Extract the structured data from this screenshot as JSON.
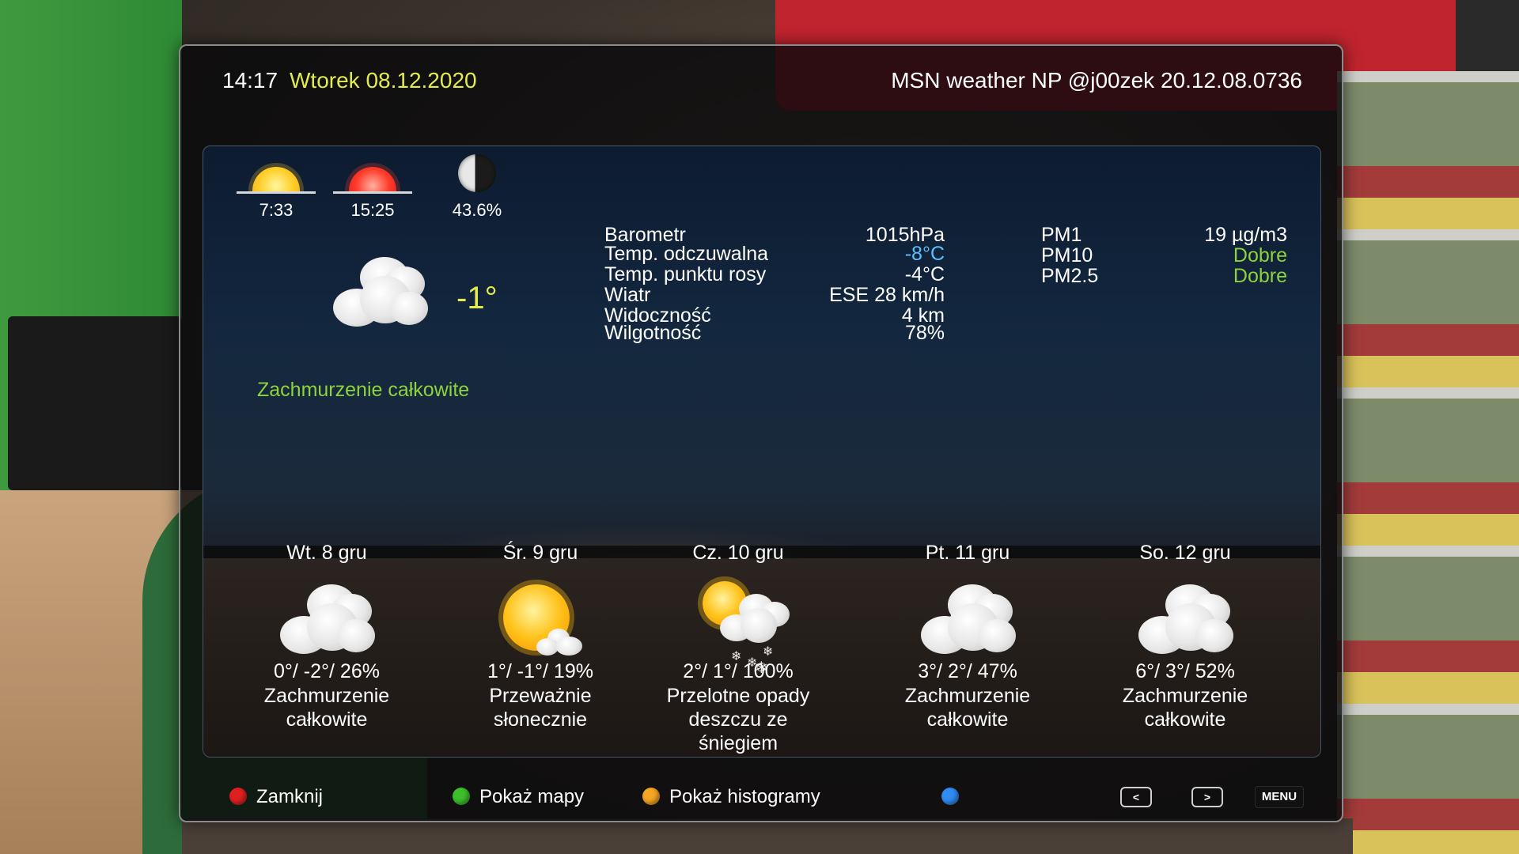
{
  "header": {
    "time": "14:17",
    "date": "Wtorek 08.12.2020",
    "title": "MSN weather NP @j00zek 20.12.08.0736"
  },
  "astro": {
    "sunrise": "7:33",
    "sunset": "15:25",
    "moon_illumination": "43.6%"
  },
  "current": {
    "temperature": "-1°",
    "description": "Zachmurzenie całkowite",
    "icon": "cloudy-icon"
  },
  "details": [
    {
      "label": "Barometr",
      "value": "1015hPa",
      "color": "#ffffff"
    },
    {
      "label": "Temp. odczuwalna",
      "value": "-8°C",
      "color": "#5bc0ff"
    },
    {
      "label": "Temp. punktu rosy",
      "value": "-4°C",
      "color": "#ffffff"
    },
    {
      "label": "Wiatr",
      "value": "ESE 28 km/h",
      "color": "#ffffff"
    },
    {
      "label": "Widoczność",
      "value": "4 km",
      "color": "#ffffff"
    },
    {
      "label": "Wilgotność",
      "value": "78%",
      "color": "#ffffff"
    }
  ],
  "air_quality": [
    {
      "label": "PM1",
      "value": "19 µg/m3",
      "color": "#ffffff"
    },
    {
      "label": "PM10",
      "value": "Dobre",
      "color": "#8ed23c"
    },
    {
      "label": "PM2.5",
      "value": "Dobre",
      "color": "#8ed23c"
    }
  ],
  "forecast": [
    {
      "day": "Wt. 8 gru",
      "temps": "0°/ -2°/ 26%",
      "description": "Zachmurzenie całkowite",
      "icon": "cloudy-icon"
    },
    {
      "day": "Śr. 9 gru",
      "temps": "1°/ -1°/ 19%",
      "description": "Przeważnie słonecznie",
      "icon": "mostly-sunny-icon"
    },
    {
      "day": "Cz. 10 gru",
      "temps": "2°/ 1°/ 100%",
      "description": "Przelotne opady deszczu ze śniegiem",
      "icon": "rain-snow-showers-icon"
    },
    {
      "day": "Pt. 11 gru",
      "temps": "3°/ 2°/ 47%",
      "description": "Zachmurzenie całkowite",
      "icon": "cloudy-icon"
    },
    {
      "day": "So. 12 gru",
      "temps": "6°/ 3°/ 52%",
      "description": "Zachmurzenie całkowite",
      "icon": "cloudy-icon"
    }
  ],
  "footer": {
    "red_label": "Zamknij",
    "green_label": "Pokaż mapy",
    "yellow_label": "Pokaż histogramy",
    "blue_label": "",
    "prev_key": "<",
    "next_key": ">",
    "menu_key": "MENU"
  },
  "colors": {
    "accent_yellow": "#e3ec4e",
    "accent_green": "#8ed23c",
    "accent_blue": "#5bc0ff",
    "red_button": "#e02020",
    "green_button": "#3cbf2a",
    "yellow_button": "#f5a623",
    "blue_button": "#2f8cf0"
  }
}
